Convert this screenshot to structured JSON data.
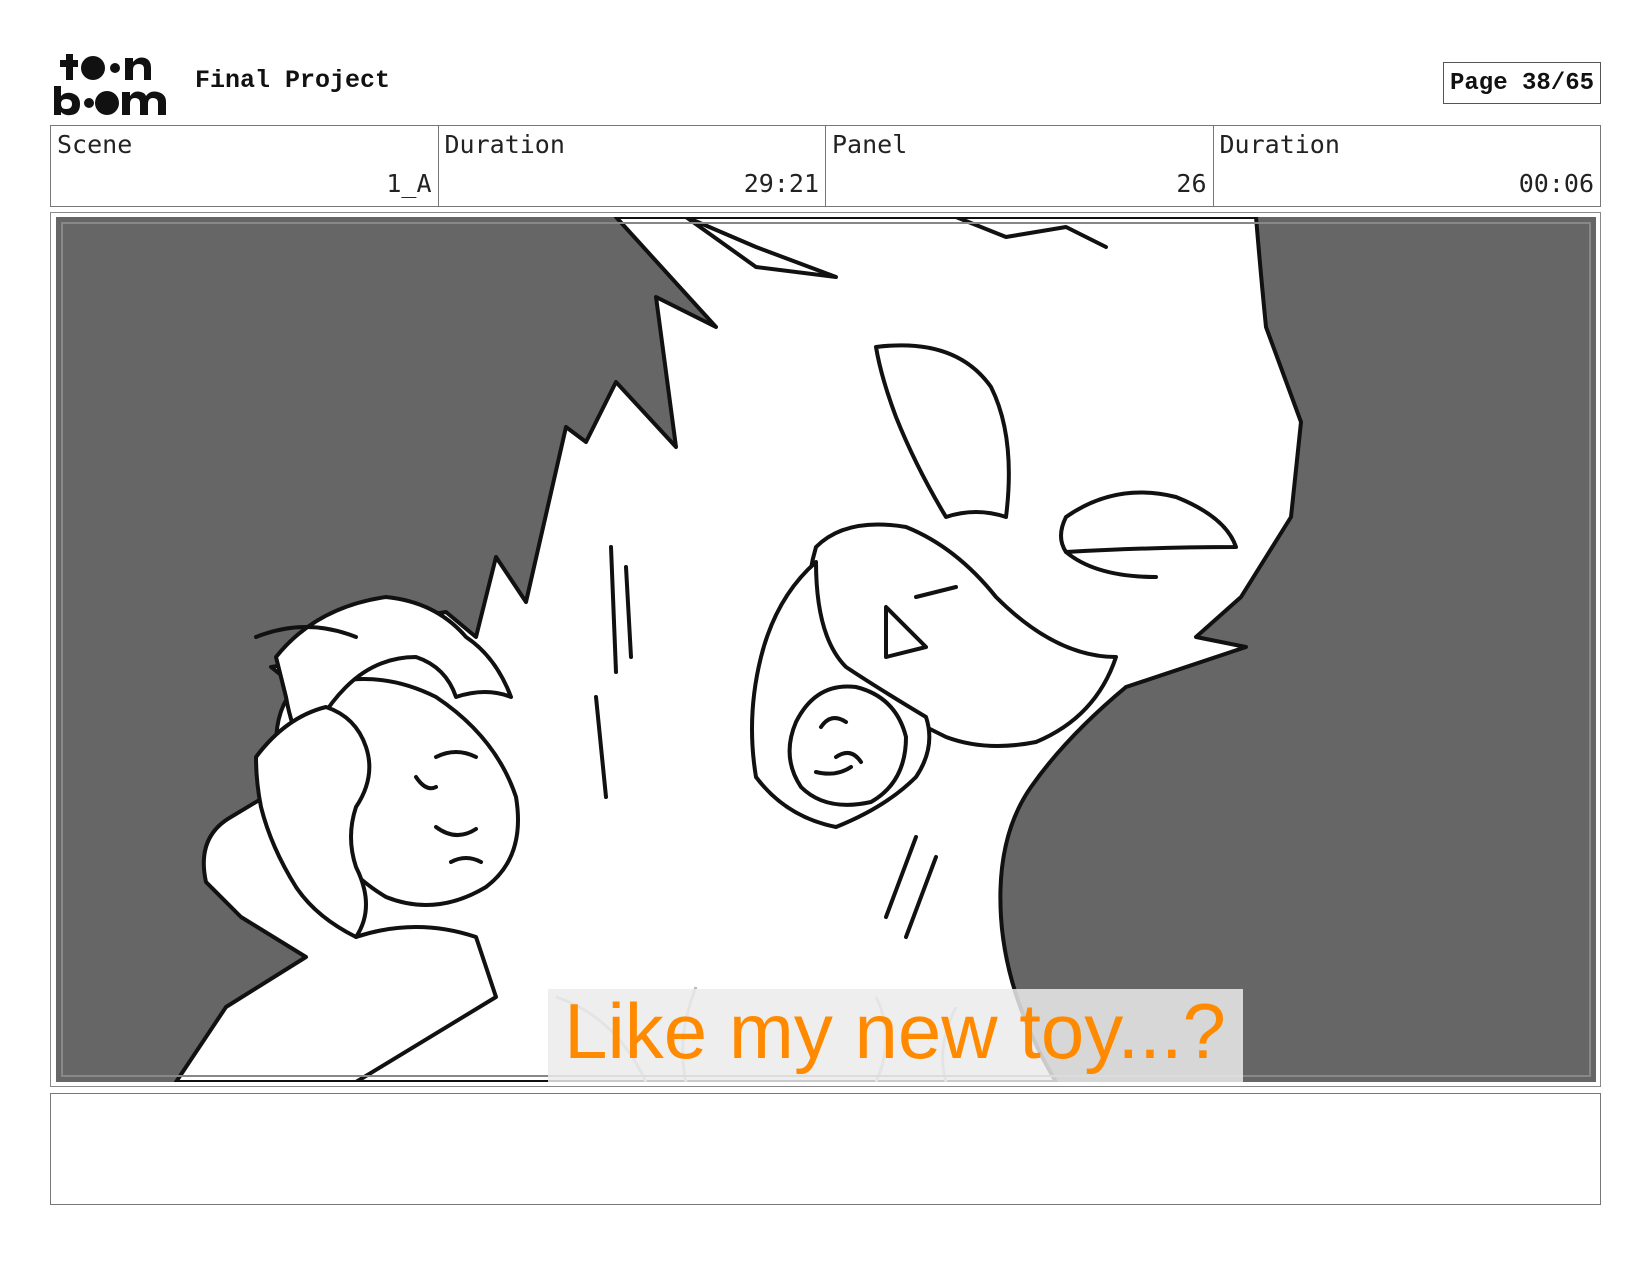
{
  "header": {
    "logo_text": "toon boom",
    "project_title": "Final Project",
    "page_indicator": "Page 38/65"
  },
  "info": {
    "scene_label": "Scene",
    "scene_value": "1_A",
    "scene_duration_label": "Duration",
    "scene_duration_value": "29:21",
    "panel_label": "Panel",
    "panel_value": "26",
    "panel_duration_label": "Duration",
    "panel_duration_value": "00:06"
  },
  "panel": {
    "background_color": "#666666",
    "caption": "Like my new toy...?",
    "caption_color": "#ff8a00"
  },
  "notes": {
    "text": ""
  }
}
